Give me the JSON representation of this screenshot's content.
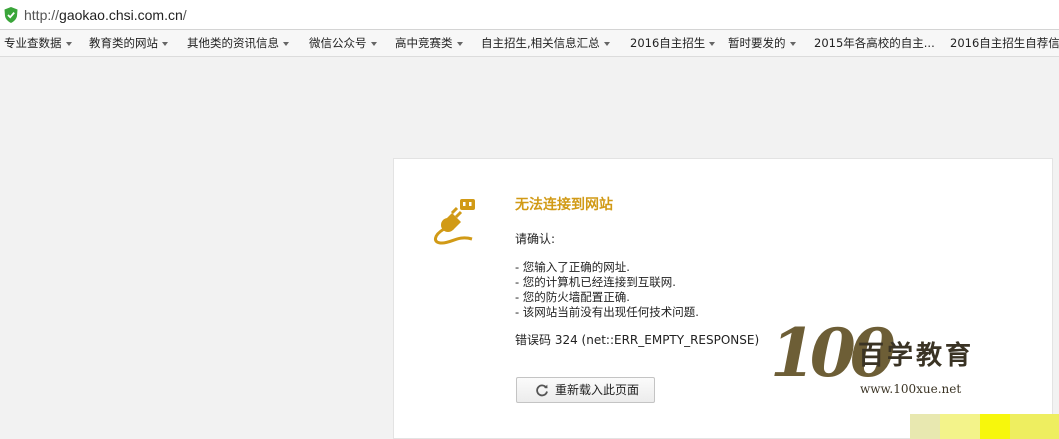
{
  "addressbar": {
    "url_prefix": "http://",
    "url_host": "gaokao.chsi.com.cn",
    "url_suffix": "/",
    "security_icon": "green-shield-icon"
  },
  "bookmarks": [
    {
      "label": "专业查数据"
    },
    {
      "label": "教育类的网站"
    },
    {
      "label": "其他类的资讯信息"
    },
    {
      "label": "微信公众号"
    },
    {
      "label": "高中竞赛类"
    },
    {
      "label": "自主招生,相关信息汇总"
    },
    {
      "label": "2016自主招生"
    },
    {
      "label": "暂时要发的"
    },
    {
      "label": "2015年各高校的自主..."
    },
    {
      "label": "2016自主招生自荐信"
    }
  ],
  "error": {
    "icon": "unplugged-plug-icon",
    "title": "无法连接到网站",
    "confirm_label": "请确认:",
    "checks": [
      "- 您输入了正确的网址.",
      "- 您的计算机已经连接到互联网.",
      "- 您的防火墙配置正确.",
      "- 该网站当前没有出现任何技术问题."
    ],
    "code_text": "错误码 324 (net::ERR_EMPTY_RESPONSE)",
    "reload_label": "重新载入此页面",
    "reload_icon": "refresh-icon"
  },
  "watermark": {
    "number": "100",
    "brand": "百学教育",
    "url": "www.100xue.net"
  },
  "colors": {
    "accent": "#d19a16",
    "shield": "#3aa53a",
    "watermark_blocks": [
      "#e8e89a",
      "#f3f38a",
      "#f7f70c",
      "#f0f05a"
    ]
  }
}
